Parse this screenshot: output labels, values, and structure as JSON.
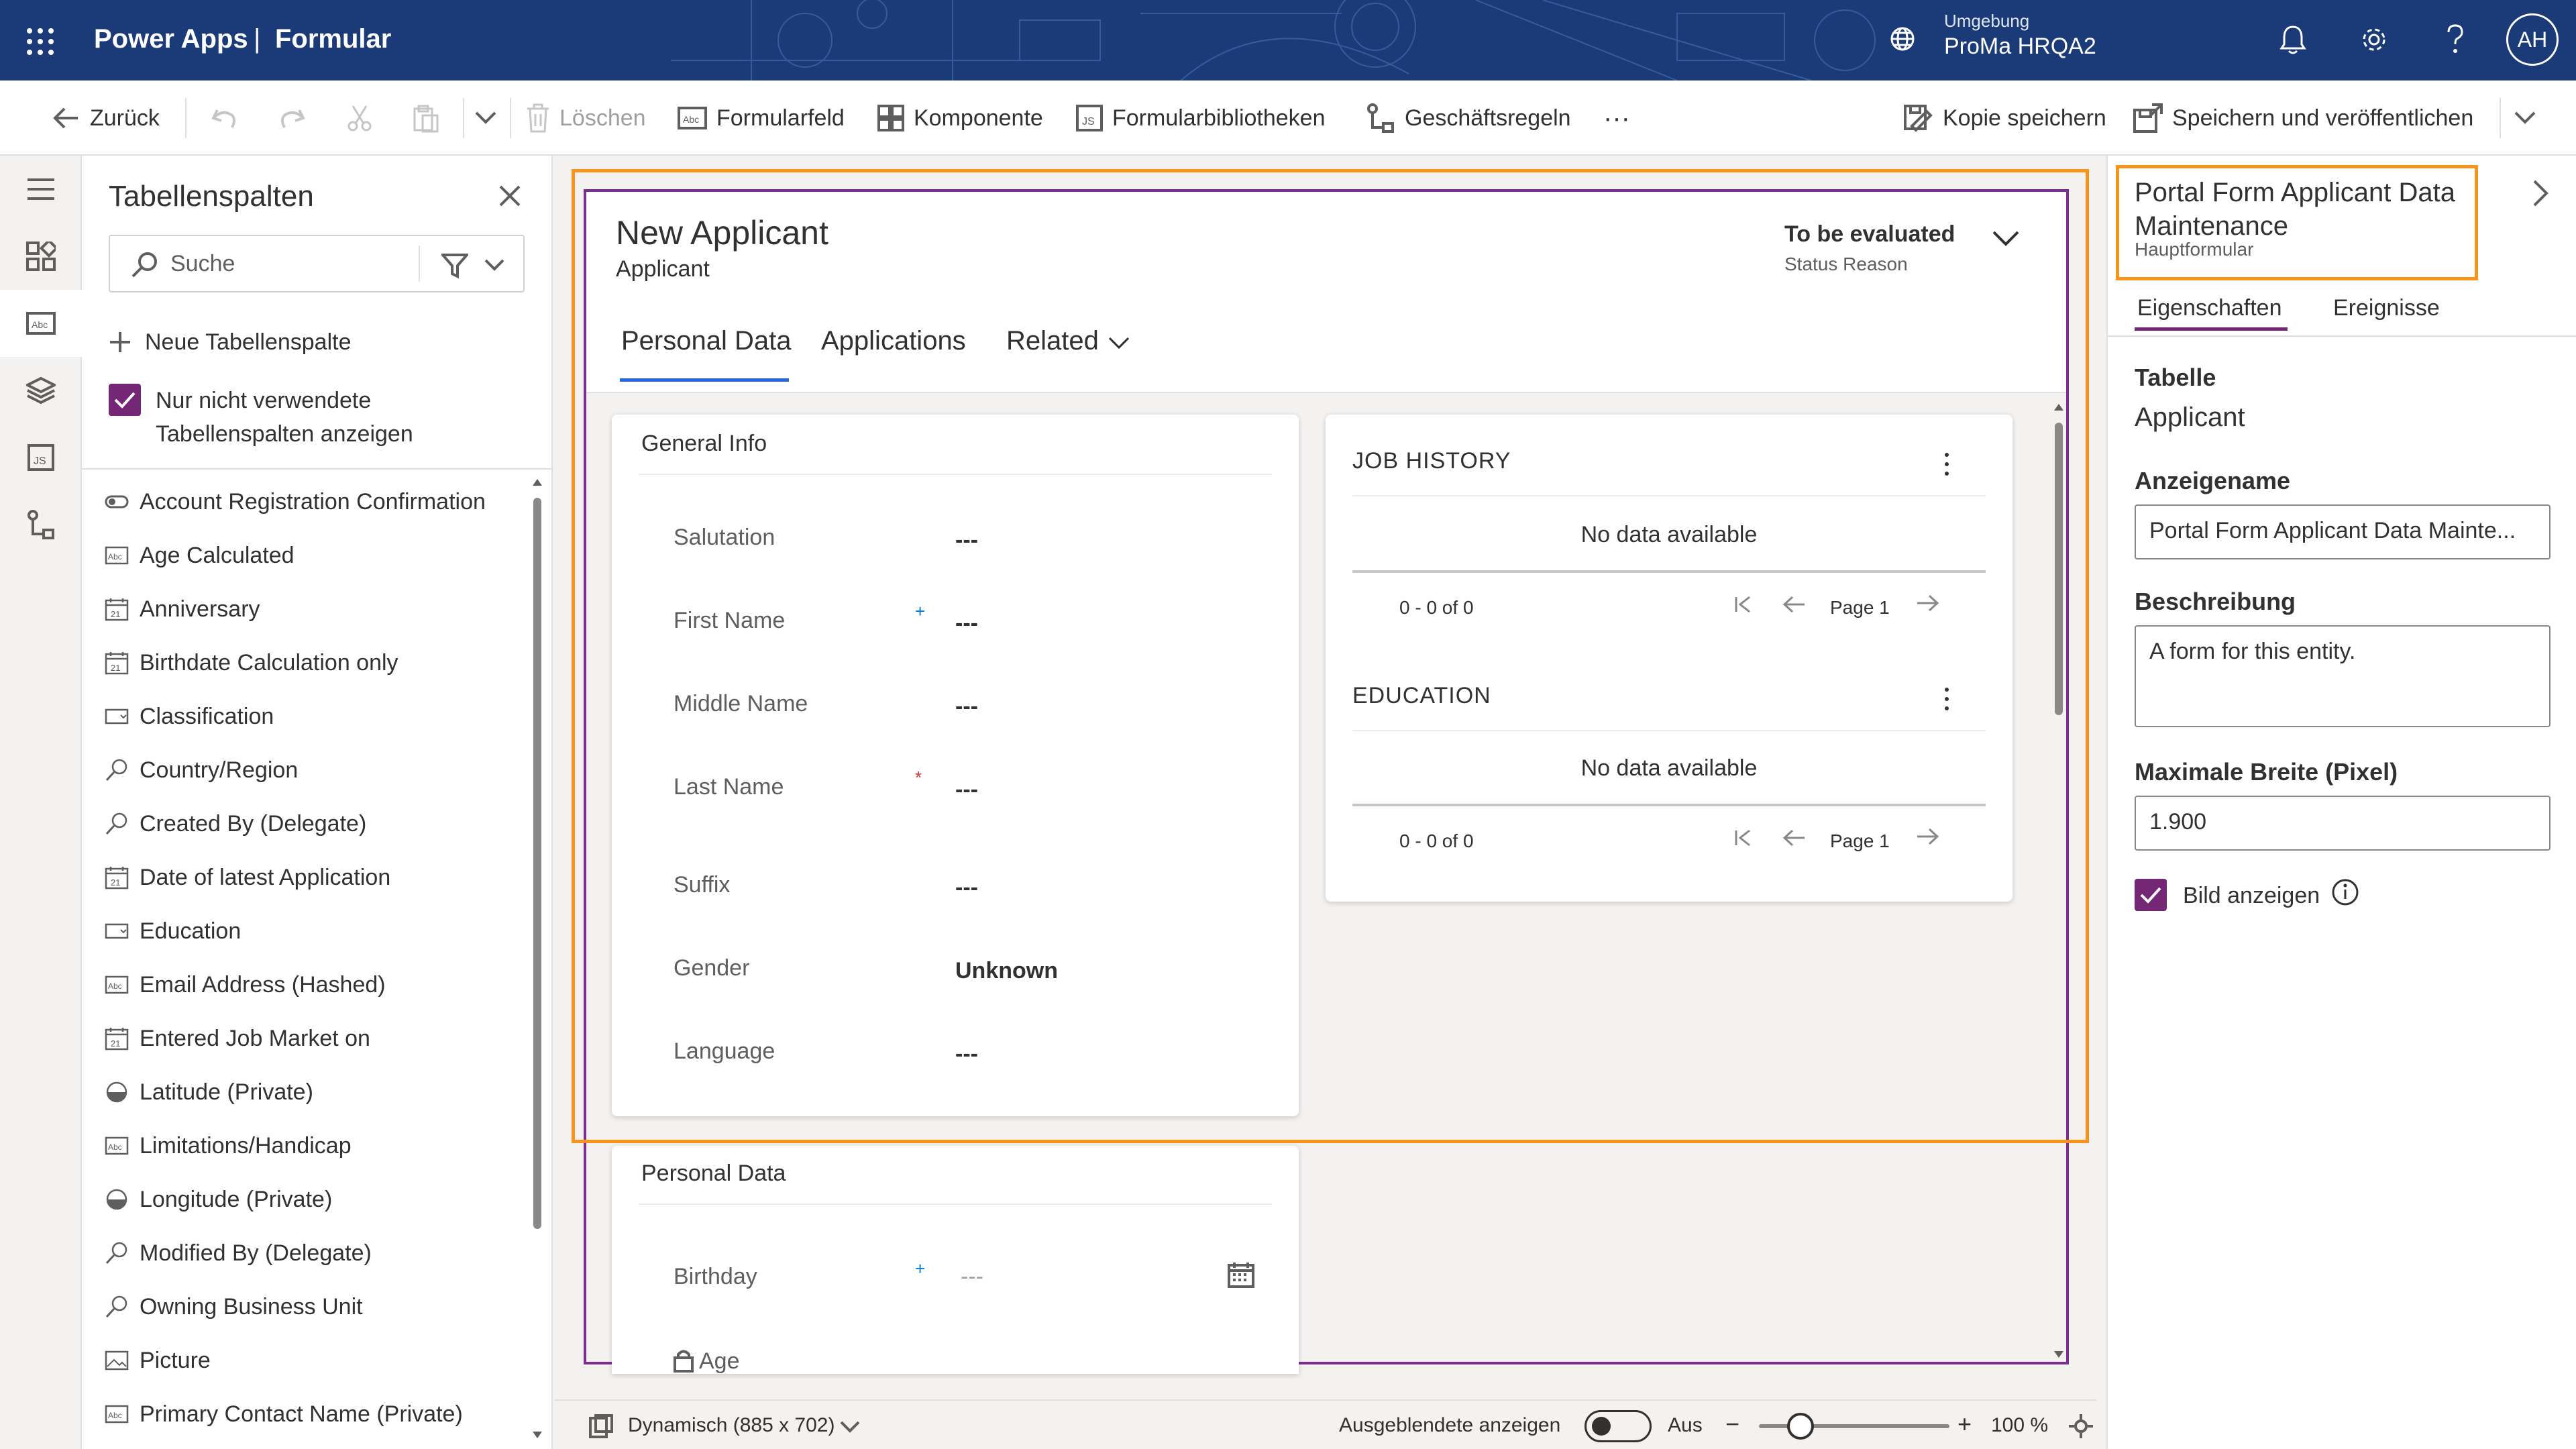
{
  "header": {
    "app": "Power Apps",
    "divider": "|",
    "title": "Formular",
    "env_label": "Umgebung",
    "env_value": "ProMa HRQA2",
    "avatar": "AH",
    "bg_color": "#1b3a78"
  },
  "toolbar": {
    "back": "Zurück",
    "delete": "Löschen",
    "form_field": "Formularfeld",
    "component": "Komponente",
    "form_libraries": "Formularbibliotheken",
    "business_rules": "Geschäftsregeln",
    "more": "···",
    "save_copy": "Kopie speichern",
    "save_publish": "Speichern und veröffentlichen"
  },
  "columns_panel": {
    "title": "Tabellenspalten",
    "search_placeholder": "Suche",
    "new_column": "Neue Tabellenspalte",
    "checkbox_line1": "Nur nicht verwendete",
    "checkbox_line2": "Tabellenspalten anzeigen",
    "fields": [
      {
        "label": "Account Registration Confirmation",
        "icon": "toggle-icon"
      },
      {
        "label": "Age Calculated",
        "icon": "text-field-icon"
      },
      {
        "label": "Anniversary",
        "icon": "calendar-icon"
      },
      {
        "label": "Birthdate Calculation only",
        "icon": "calendar-icon"
      },
      {
        "label": "Classification",
        "icon": "dropdown-icon"
      },
      {
        "label": "Country/Region",
        "icon": "lookup-icon"
      },
      {
        "label": "Created By (Delegate)",
        "icon": "lookup-icon"
      },
      {
        "label": "Date of latest Application",
        "icon": "calendar-icon"
      },
      {
        "label": "Education",
        "icon": "dropdown-icon"
      },
      {
        "label": "Email Address (Hashed)",
        "icon": "text-field-icon"
      },
      {
        "label": "Entered Job Market on",
        "icon": "calendar-icon"
      },
      {
        "label": "Latitude (Private)",
        "icon": "decimal-icon"
      },
      {
        "label": "Limitations/Handicap",
        "icon": "text-field-icon"
      },
      {
        "label": "Longitude (Private)",
        "icon": "decimal-icon"
      },
      {
        "label": "Modified By (Delegate)",
        "icon": "lookup-icon"
      },
      {
        "label": "Owning Business Unit",
        "icon": "lookup-icon"
      },
      {
        "label": "Picture",
        "icon": "image-icon"
      },
      {
        "label": "Primary Contact Name (Private)",
        "icon": "text-field-icon"
      }
    ]
  },
  "form": {
    "title": "New Applicant",
    "subtitle": "Applicant",
    "status_value": "To be evaluated",
    "status_label": "Status Reason",
    "tabs": [
      "Personal Data",
      "Applications",
      "Related"
    ],
    "general_info": {
      "title": "General Info",
      "fields": [
        {
          "label": "Salutation",
          "value": "---",
          "req": ""
        },
        {
          "label": "First Name",
          "value": "---",
          "req": "+"
        },
        {
          "label": "Middle Name",
          "value": "---",
          "req": ""
        },
        {
          "label": "Last Name",
          "value": "---",
          "req": "*"
        },
        {
          "label": "Suffix",
          "value": "---",
          "req": ""
        },
        {
          "label": "Gender",
          "value": "Unknown",
          "req": ""
        },
        {
          "label": "Language",
          "value": "---",
          "req": ""
        }
      ]
    },
    "job_history": {
      "title": "JOB HISTORY",
      "empty": "No data available",
      "range": "0 - 0 of 0",
      "page": "Page 1"
    },
    "education": {
      "title": "EDUCATION",
      "empty": "No data available",
      "range": "0 - 0 of 0",
      "page": "Page 1"
    },
    "personal_data": {
      "title": "Personal Data",
      "birthday_label": "Birthday",
      "birthday_req": "+",
      "birthday_value": "---",
      "age_label": "Age"
    }
  },
  "statusbar": {
    "layout": "Dynamisch (885 x 702)",
    "show_hidden": "Ausgeblendete anzeigen",
    "toggle_state": "Aus",
    "zoom_minus": "−",
    "zoom_plus": "+",
    "zoom": "100 %"
  },
  "properties": {
    "title_line1": "Portal Form Applicant Data",
    "title_line2": "Maintenance",
    "form_type": "Hauptformular",
    "tabs": [
      "Eigenschaften",
      "Ereignisse"
    ],
    "table_label": "Tabelle",
    "table_value": "Applicant",
    "display_name_label": "Anzeigename",
    "display_name_value": "Portal Form Applicant Data Mainte...",
    "description_label": "Beschreibung",
    "description_value": "A form for this entity.",
    "max_width_label": "Maximale Breite (Pixel)",
    "max_width_value": "1.900",
    "show_image": "Bild anzeigen"
  },
  "colors": {
    "accent_purple": "#742774",
    "selection_orange": "#f7941d",
    "required_blue": "#0078d4",
    "required_red": "#d13438"
  }
}
